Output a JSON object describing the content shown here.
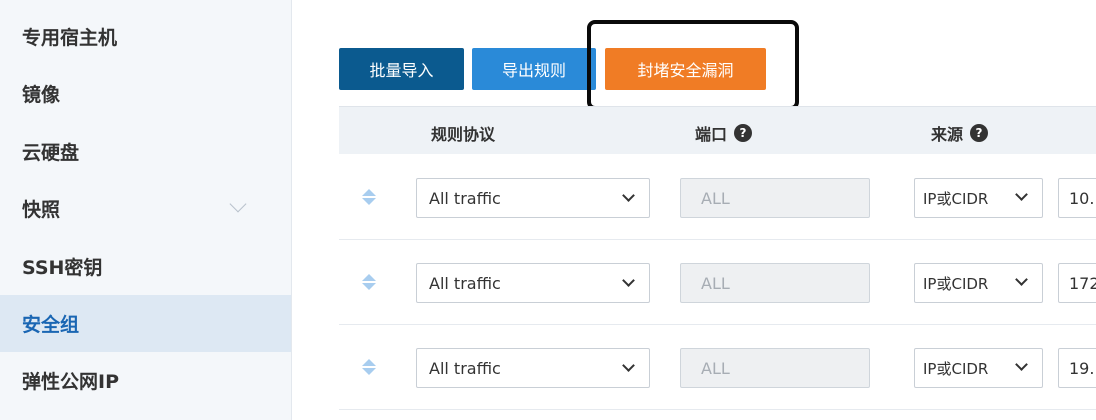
{
  "sidebar": {
    "items": [
      {
        "label": "专用宿主机"
      },
      {
        "label": "镜像"
      },
      {
        "label": "云硬盘"
      },
      {
        "label": "快照"
      },
      {
        "label": "SSH密钥"
      },
      {
        "label": "安全组"
      },
      {
        "label": "弹性公网IP"
      }
    ]
  },
  "toolbar": {
    "import_label": "批量导入",
    "export_label": "导出规则",
    "block_label": "封堵安全漏洞"
  },
  "table": {
    "headers": {
      "protocol": "规则协议",
      "port": "端口",
      "source": "来源"
    },
    "help_glyph": "?",
    "rows": [
      {
        "protocol": "All traffic",
        "port": "ALL",
        "source_type": "IP或CIDR",
        "source_value": "10."
      },
      {
        "protocol": "All traffic",
        "port": "ALL",
        "source_type": "IP或CIDR",
        "source_value": "172"
      },
      {
        "protocol": "All traffic",
        "port": "ALL",
        "source_type": "IP或CIDR",
        "source_value": "19."
      }
    ]
  },
  "colors": {
    "import_button": "#0b5a8f",
    "export_button": "#2a8ad8",
    "block_button": "#f07c25",
    "active_nav": "#1a66b3"
  }
}
